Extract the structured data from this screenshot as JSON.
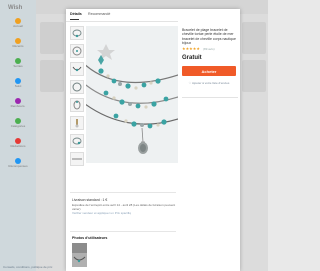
{
  "background": {
    "logo": "Wish",
    "nav_items": [
      "Accueil",
      "Récents",
      "Sorties",
      "Suivi",
      "Rembours.",
      "Catégories",
      "Réductions",
      "Récompenses"
    ],
    "footer_text": "Conseils, conditions, politique de prix"
  },
  "tabs": [
    {
      "label": "Détails",
      "active": true
    },
    {
      "label": "Recommandé",
      "active": false
    }
  ],
  "product": {
    "title": "Bracelet de plage bracelet de cheville tortue perle étoile de mer bracelet de cheville corps nautique bijoux",
    "stars": "★★★★★",
    "reviews": "(89 avis)",
    "price": "Gratuit",
    "buy_label": "Acheter",
    "wishlist_label": "Ajouter à votre liste d'envies"
  },
  "shipping": {
    "line1": "Livraison standard : 1 €",
    "line2": "Expédiée de l'entrepôt entre avril 14 - avril 28 (Les délais de livraison peuvent varier)",
    "link": "Vérifier vendeur et appliquer un Prix spécifiq"
  },
  "photos_title": "Photos d'utilisateurs",
  "colors": {
    "accent": "#f05a28",
    "star": "#f0a020",
    "sidebar_dots": [
      "#f0a020",
      "#f0a020",
      "#4caf50",
      "#2196f3",
      "#9c27b0",
      "#4caf50",
      "#e53935",
      "#2196f3"
    ]
  }
}
